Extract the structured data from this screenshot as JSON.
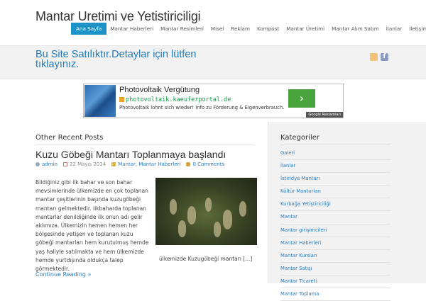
{
  "site": {
    "title": "Mantar Uretimi ve Yetistiriciligi"
  },
  "nav": {
    "items": [
      "Ana Sayfa",
      "Mantar Haberleri",
      "Mantar Resimleri",
      "Misel",
      "Reklam",
      "Kompost",
      "Mantar Üretimi",
      "Mantar Alım Satım",
      "İlanlar",
      "İletişim"
    ],
    "active": "Ana Sayfa"
  },
  "banner": {
    "text": "Bu Site Satılıktır.Detaylar için lütfen tıklayınız."
  },
  "ad": {
    "title": "Photovoltaik Vergütung",
    "url": "photovoltaik.kaeuferportal.de",
    "desc": "Photovoltaik lohnt sich wieder! Info zu Förderung & Eigenverbrauch.",
    "button": "›",
    "badge": "Google Reklamları"
  },
  "main": {
    "header": "Other Recent Posts",
    "post": {
      "title": "Kuzu Göbeği Mantarı Toplanmaya başlandı",
      "author": "admin",
      "date": "22 Mayıs 2014",
      "categories": "Mantar, Mantar Haberleri",
      "comments": "0 Comments",
      "body": "Bildiğiniz gibi ilk bahar ve son bahar mevsimlerinde ülkemizde en çok toplanan mantar çeşitlerinin başında kuzugöbeği mantarı gelmektedir. ilkbaharda toplanan mantarlar denildiğinde ilk onun adı gelir aklımıza. Ülkemizin hemen hemen her bölgesinde yetişen ve toplanan kuzu göbeği mantarları hem kurutulmuş hemde yaş haliyle satılmakta ve hem ülkemizde hemde yurtdışında oldukça talep görmektedir.",
      "body_tail": "ülkemizde Kuzugöbeği mantarı [...]",
      "continue": "Continue Reading »"
    }
  },
  "sidebar": {
    "title": "Kategoriler",
    "items": [
      "Galeri",
      "İlanlar",
      "İstiridye Mantarı",
      "Kültür Mantarları",
      "Kurbağa Yetiştiriciliği",
      "Mantar",
      "Mantar girişimcileri",
      "Mantar Haberleri",
      "Mantar Kursları",
      "Mantar Satışı",
      "Mantar Ticareti",
      "Mantar Toplama"
    ]
  },
  "icons": [
    "rss-icon",
    "facebook-icon",
    "user-icon",
    "calendar-icon",
    "folder-icon",
    "comment-icon"
  ],
  "colors": {
    "accent": "#1b93c6",
    "link": "#2a7cc0",
    "banner_text": "#1f7ab8",
    "ad_button": "#49a43d"
  }
}
